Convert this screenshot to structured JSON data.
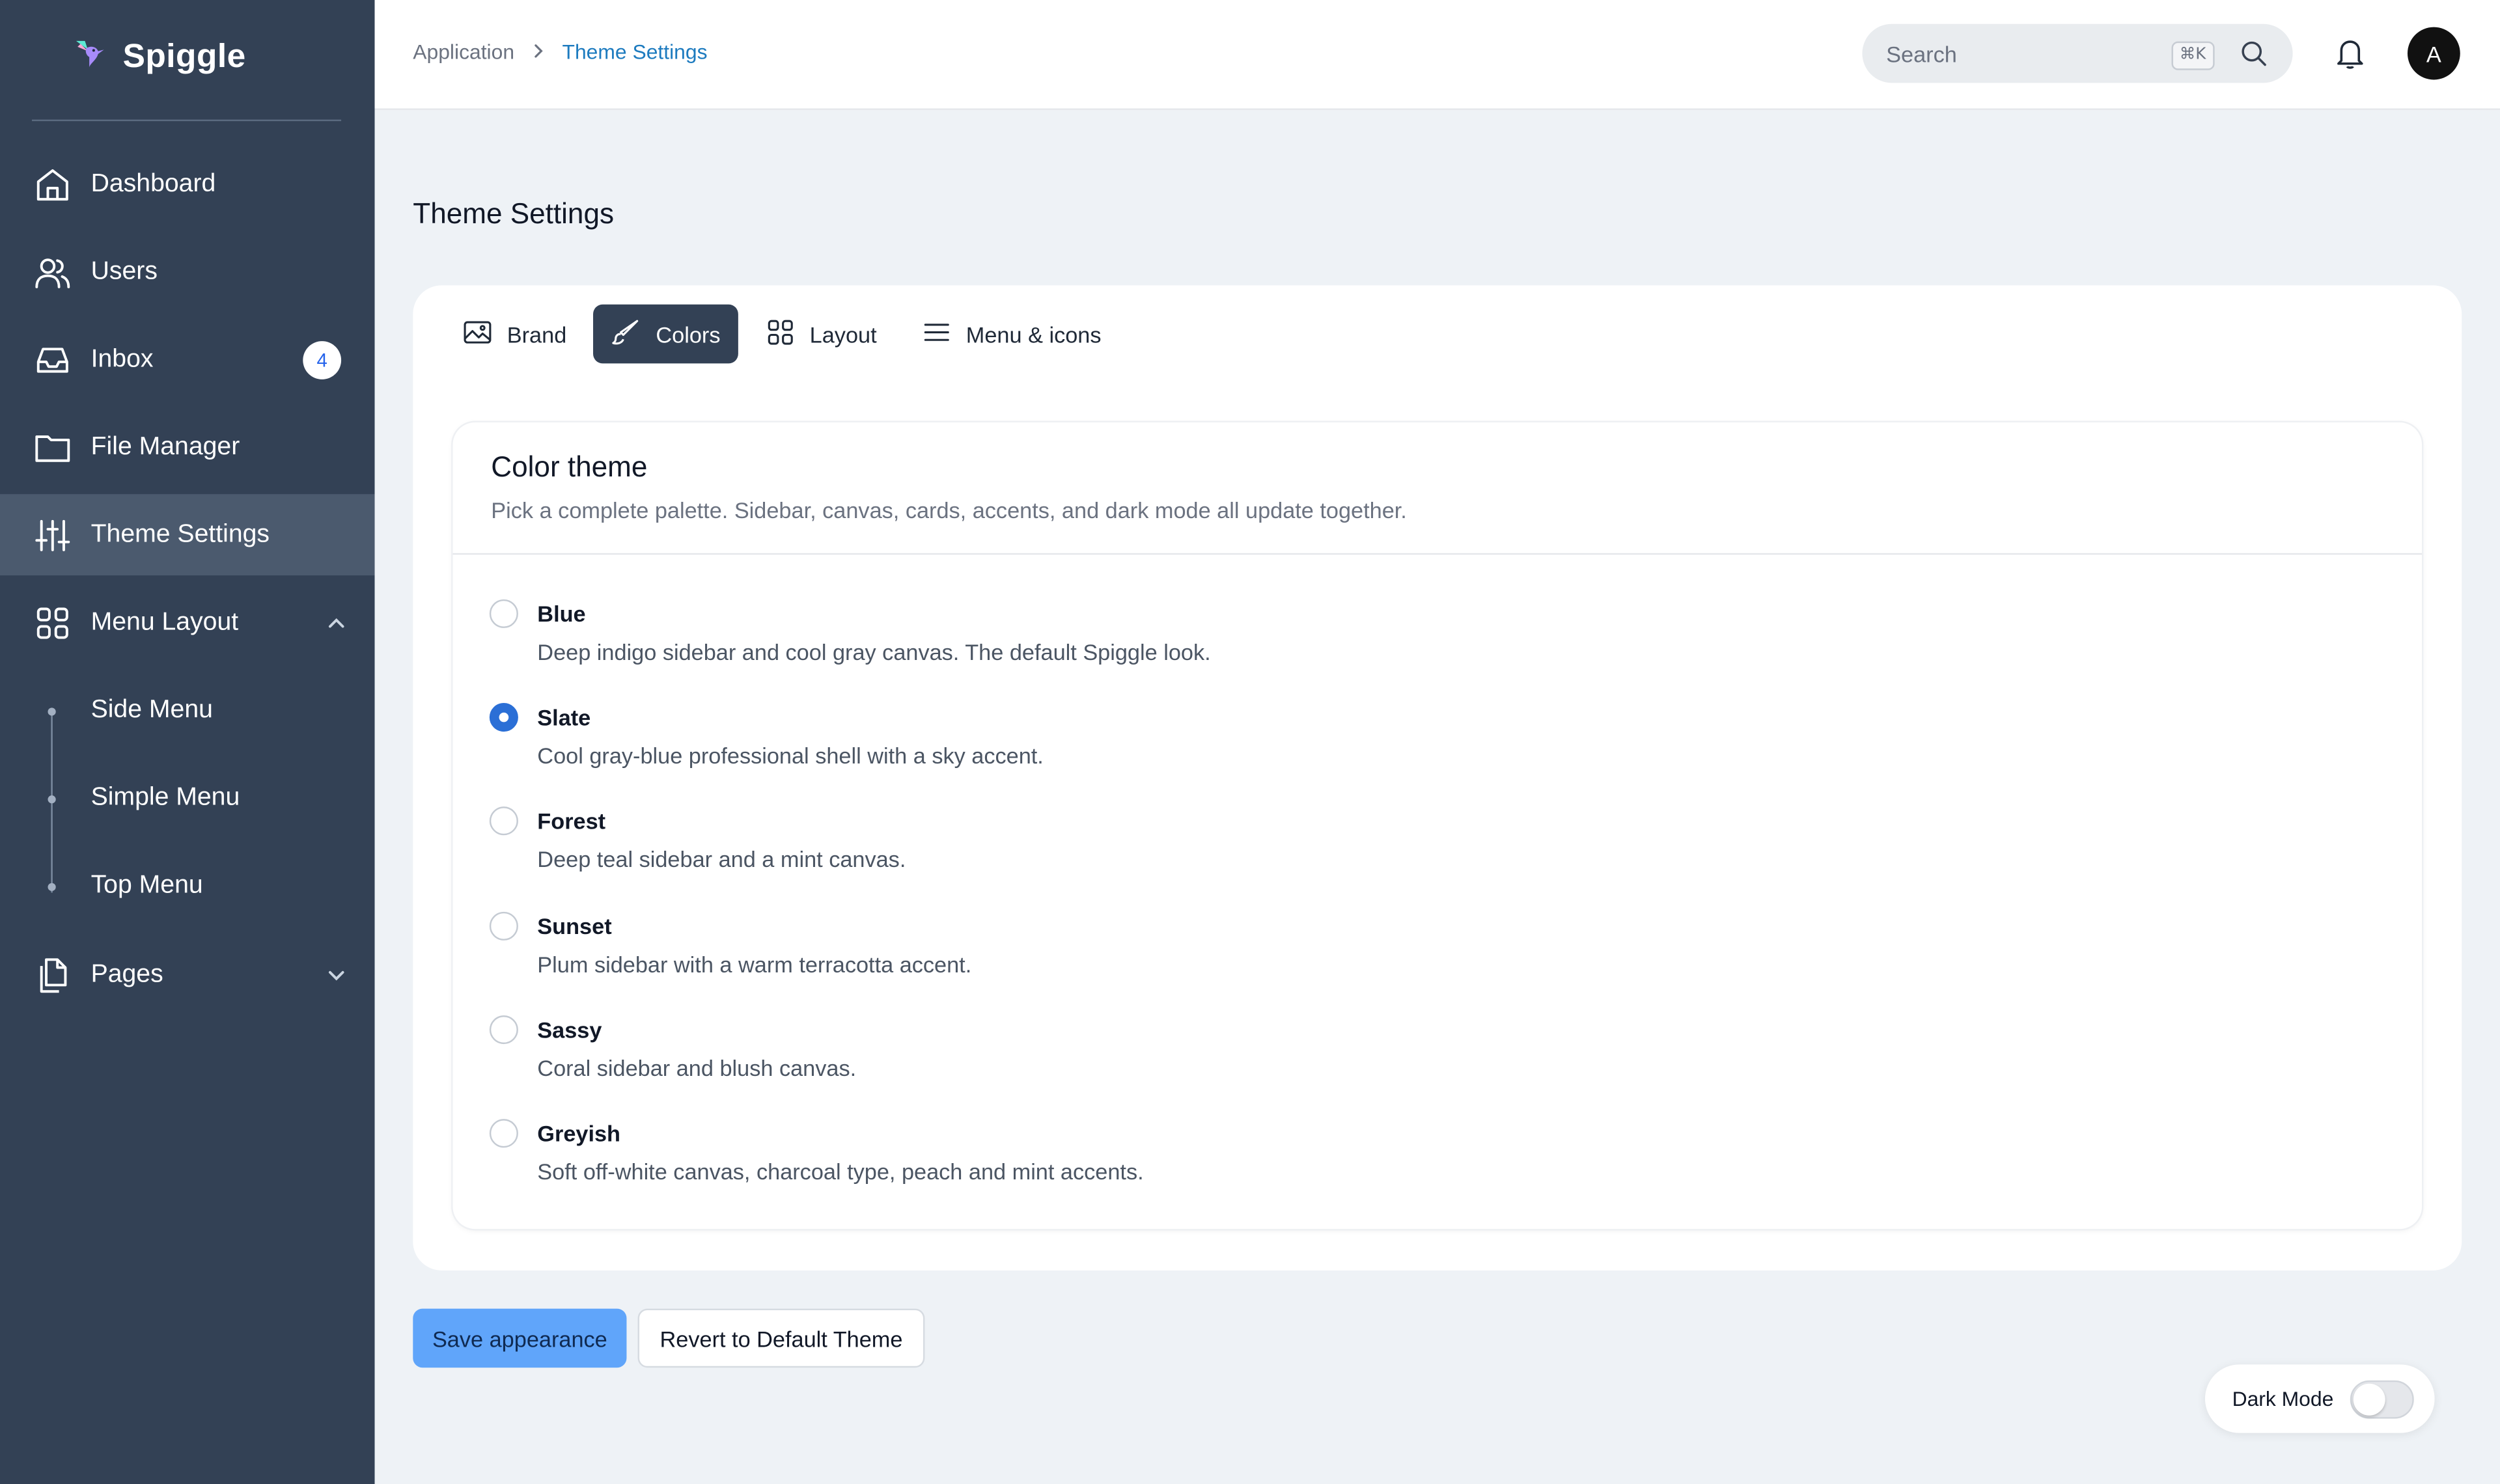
{
  "app": {
    "name": "Spiggle"
  },
  "sidebar": {
    "items": [
      {
        "label": "Dashboard",
        "icon": "home-icon"
      },
      {
        "label": "Users",
        "icon": "users-icon"
      },
      {
        "label": "Inbox",
        "icon": "inbox-icon",
        "badge": "4"
      },
      {
        "label": "File Manager",
        "icon": "folder-icon"
      },
      {
        "label": "Theme Settings",
        "icon": "sliders-icon",
        "active": true
      },
      {
        "label": "Menu Layout",
        "icon": "grid-icon",
        "expanded": true
      },
      {
        "label": "Pages",
        "icon": "pages-icon",
        "expanded": false
      }
    ],
    "submenu": [
      {
        "label": "Side Menu"
      },
      {
        "label": "Simple Menu"
      },
      {
        "label": "Top Menu"
      }
    ]
  },
  "header": {
    "breadcrumb": {
      "parent": "Application",
      "current": "Theme Settings"
    },
    "search": {
      "placeholder": "Search",
      "shortcut": "⌘K"
    },
    "avatar_initial": "A"
  },
  "main": {
    "title": "Theme Settings",
    "tabs": [
      {
        "label": "Brand",
        "icon": "image-icon"
      },
      {
        "label": "Colors",
        "icon": "brush-icon",
        "active": true
      },
      {
        "label": "Layout",
        "icon": "grid-icon"
      },
      {
        "label": "Menu & icons",
        "icon": "menu-icon"
      }
    ],
    "color_theme": {
      "title": "Color theme",
      "subtitle": "Pick a complete palette. Sidebar, canvas, cards, accents, and dark mode all update together.",
      "options": [
        {
          "name": "Blue",
          "description": "Deep indigo sidebar and cool gray canvas. The default Spiggle look.",
          "selected": false
        },
        {
          "name": "Slate",
          "description": "Cool gray-blue professional shell with a sky accent.",
          "selected": true
        },
        {
          "name": "Forest",
          "description": "Deep teal sidebar and a mint canvas.",
          "selected": false
        },
        {
          "name": "Sunset",
          "description": "Plum sidebar with a warm terracotta accent.",
          "selected": false
        },
        {
          "name": "Sassy",
          "description": "Coral sidebar and blush canvas.",
          "selected": false
        },
        {
          "name": "Greyish",
          "description": "Soft off-white canvas, charcoal type, peach and mint accents.",
          "selected": false
        }
      ]
    },
    "actions": {
      "save_label": "Save appearance",
      "revert_label": "Revert to Default Theme"
    },
    "dark_mode": {
      "label": "Dark Mode",
      "enabled": false
    }
  },
  "colors": {
    "sidebar_bg": "#334155",
    "sidebar_active": "#4b5a6e",
    "canvas": "#eef2f6",
    "accent": "#2b6fd6",
    "save_button": "#60a5fa",
    "breadcrumb_current": "#1d7bbf"
  }
}
